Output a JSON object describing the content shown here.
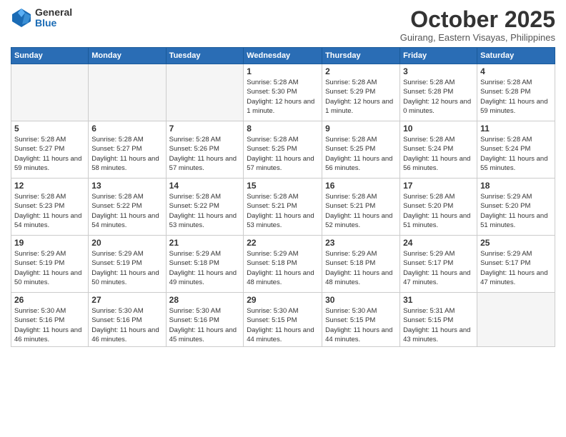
{
  "logo": {
    "general": "General",
    "blue": "Blue"
  },
  "header": {
    "month": "October 2025",
    "location": "Guirang, Eastern Visayas, Philippines"
  },
  "weekdays": [
    "Sunday",
    "Monday",
    "Tuesday",
    "Wednesday",
    "Thursday",
    "Friday",
    "Saturday"
  ],
  "weeks": [
    [
      {
        "day": "",
        "info": ""
      },
      {
        "day": "",
        "info": ""
      },
      {
        "day": "",
        "info": ""
      },
      {
        "day": "1",
        "info": "Sunrise: 5:28 AM\nSunset: 5:30 PM\nDaylight: 12 hours\nand 1 minute."
      },
      {
        "day": "2",
        "info": "Sunrise: 5:28 AM\nSunset: 5:29 PM\nDaylight: 12 hours\nand 1 minute."
      },
      {
        "day": "3",
        "info": "Sunrise: 5:28 AM\nSunset: 5:28 PM\nDaylight: 12 hours\nand 0 minutes."
      },
      {
        "day": "4",
        "info": "Sunrise: 5:28 AM\nSunset: 5:28 PM\nDaylight: 11 hours\nand 59 minutes."
      }
    ],
    [
      {
        "day": "5",
        "info": "Sunrise: 5:28 AM\nSunset: 5:27 PM\nDaylight: 11 hours\nand 59 minutes."
      },
      {
        "day": "6",
        "info": "Sunrise: 5:28 AM\nSunset: 5:27 PM\nDaylight: 11 hours\nand 58 minutes."
      },
      {
        "day": "7",
        "info": "Sunrise: 5:28 AM\nSunset: 5:26 PM\nDaylight: 11 hours\nand 57 minutes."
      },
      {
        "day": "8",
        "info": "Sunrise: 5:28 AM\nSunset: 5:25 PM\nDaylight: 11 hours\nand 57 minutes."
      },
      {
        "day": "9",
        "info": "Sunrise: 5:28 AM\nSunset: 5:25 PM\nDaylight: 11 hours\nand 56 minutes."
      },
      {
        "day": "10",
        "info": "Sunrise: 5:28 AM\nSunset: 5:24 PM\nDaylight: 11 hours\nand 56 minutes."
      },
      {
        "day": "11",
        "info": "Sunrise: 5:28 AM\nSunset: 5:24 PM\nDaylight: 11 hours\nand 55 minutes."
      }
    ],
    [
      {
        "day": "12",
        "info": "Sunrise: 5:28 AM\nSunset: 5:23 PM\nDaylight: 11 hours\nand 54 minutes."
      },
      {
        "day": "13",
        "info": "Sunrise: 5:28 AM\nSunset: 5:22 PM\nDaylight: 11 hours\nand 54 minutes."
      },
      {
        "day": "14",
        "info": "Sunrise: 5:28 AM\nSunset: 5:22 PM\nDaylight: 11 hours\nand 53 minutes."
      },
      {
        "day": "15",
        "info": "Sunrise: 5:28 AM\nSunset: 5:21 PM\nDaylight: 11 hours\nand 53 minutes."
      },
      {
        "day": "16",
        "info": "Sunrise: 5:28 AM\nSunset: 5:21 PM\nDaylight: 11 hours\nand 52 minutes."
      },
      {
        "day": "17",
        "info": "Sunrise: 5:28 AM\nSunset: 5:20 PM\nDaylight: 11 hours\nand 51 minutes."
      },
      {
        "day": "18",
        "info": "Sunrise: 5:29 AM\nSunset: 5:20 PM\nDaylight: 11 hours\nand 51 minutes."
      }
    ],
    [
      {
        "day": "19",
        "info": "Sunrise: 5:29 AM\nSunset: 5:19 PM\nDaylight: 11 hours\nand 50 minutes."
      },
      {
        "day": "20",
        "info": "Sunrise: 5:29 AM\nSunset: 5:19 PM\nDaylight: 11 hours\nand 50 minutes."
      },
      {
        "day": "21",
        "info": "Sunrise: 5:29 AM\nSunset: 5:18 PM\nDaylight: 11 hours\nand 49 minutes."
      },
      {
        "day": "22",
        "info": "Sunrise: 5:29 AM\nSunset: 5:18 PM\nDaylight: 11 hours\nand 48 minutes."
      },
      {
        "day": "23",
        "info": "Sunrise: 5:29 AM\nSunset: 5:18 PM\nDaylight: 11 hours\nand 48 minutes."
      },
      {
        "day": "24",
        "info": "Sunrise: 5:29 AM\nSunset: 5:17 PM\nDaylight: 11 hours\nand 47 minutes."
      },
      {
        "day": "25",
        "info": "Sunrise: 5:29 AM\nSunset: 5:17 PM\nDaylight: 11 hours\nand 47 minutes."
      }
    ],
    [
      {
        "day": "26",
        "info": "Sunrise: 5:30 AM\nSunset: 5:16 PM\nDaylight: 11 hours\nand 46 minutes."
      },
      {
        "day": "27",
        "info": "Sunrise: 5:30 AM\nSunset: 5:16 PM\nDaylight: 11 hours\nand 46 minutes."
      },
      {
        "day": "28",
        "info": "Sunrise: 5:30 AM\nSunset: 5:16 PM\nDaylight: 11 hours\nand 45 minutes."
      },
      {
        "day": "29",
        "info": "Sunrise: 5:30 AM\nSunset: 5:15 PM\nDaylight: 11 hours\nand 44 minutes."
      },
      {
        "day": "30",
        "info": "Sunrise: 5:30 AM\nSunset: 5:15 PM\nDaylight: 11 hours\nand 44 minutes."
      },
      {
        "day": "31",
        "info": "Sunrise: 5:31 AM\nSunset: 5:15 PM\nDaylight: 11 hours\nand 43 minutes."
      },
      {
        "day": "",
        "info": ""
      }
    ]
  ]
}
